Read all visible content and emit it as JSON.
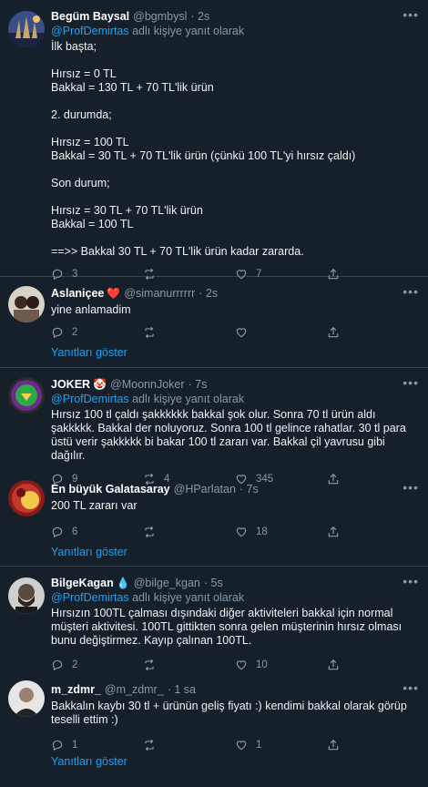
{
  "colors": {
    "background": "#15202b",
    "link": "#1da1f2",
    "muted": "#8899a6",
    "divider": "#38444d",
    "text": "#f2f2f2"
  },
  "replying_suffix": "adlı kişiye yanıt olarak",
  "show_replies_label": "Yanıtları göster",
  "tweets": [
    {
      "name": "Begüm Baysal",
      "handle": "@bgmbysl",
      "time": "· 2s",
      "reply_to": "@ProfDemirtas",
      "text": "İlk başta;\n\nHırsız = 0 TL\nBakkal = 130 TL + 70 TL'lik ürün\n\n2. durumda;\n\nHırsız = 100 TL\nBakkal = 30 TL + 70 TL'lik ürün (çünkü 100 TL'yi hırsız çaldı)\n\nSon durum;\n\nHırsız = 30 TL + 70 TL'lik ürün\nBakkal = 100 TL\n\n==>> Bakkal 30 TL + 70 TL'lik ürün kadar zararda.",
      "replies": "3",
      "retweets": "",
      "likes": "7"
    },
    {
      "name": "Aslaniçee",
      "emoji": "❤️",
      "handle": "@simanurrrrrr",
      "time": "· 2s",
      "text": "yine anlamadim",
      "replies": "2",
      "retweets": "",
      "likes": ""
    },
    {
      "name": "JOKER",
      "emoji": "🤡",
      "handle": "@MoonnJoker",
      "time": "· 7s",
      "reply_to": "@ProfDemirtas",
      "text": "Hırsız 100 tl çaldı şakkkkkk bakkal şok olur. Sonra 70 tl ürün aldı şakkkkk. Bakkal der noluyoruz. Sonra 100 tl gelince rahatlar. 30 tl para üstü verir şakkkkk bi bakar 100 tl zararı var. Bakkal çil yavrusu gibi dağılır.",
      "replies": "9",
      "retweets": "4",
      "likes": "345"
    },
    {
      "name": "En büyük Galatasaray",
      "handle": "@HParlatan",
      "time": "· 7s",
      "text": "200 TL zararı var",
      "replies": "6",
      "retweets": "",
      "likes": "18"
    },
    {
      "name": "BilgeKagan",
      "emoji": "💧",
      "handle": "@bilge_kgan",
      "time": "· 5s",
      "reply_to": "@ProfDemirtas",
      "text": "Hırsızın 100TL çalması dışındaki diğer aktiviteleri bakkal için normal müşteri aktivitesi. 100TL gittikten sonra gelen müşterinin hırsız olması bunu değiştirmez. Kayıp çalınan 100TL.",
      "replies": "2",
      "retweets": "",
      "likes": "10"
    },
    {
      "name": "m_zdmr_",
      "handle": "@m_zdmr_",
      "time": "· 1 sa",
      "text": "Bakkalın kaybı 30 tl + ürünün geliş fiyatı :) kendimi bakkal olarak görüp teselli ettim :)",
      "replies": "1",
      "retweets": "",
      "likes": "1"
    }
  ],
  "icons": {
    "reply": "reply-icon",
    "retweet": "retweet-icon",
    "like": "like-icon",
    "share": "share-icon",
    "more": "more-icon",
    "verified_emoji": "emoji"
  }
}
